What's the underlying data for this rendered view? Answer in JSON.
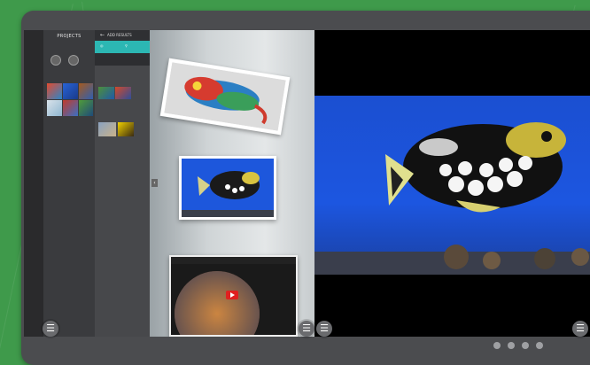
{
  "projects_panel": {
    "title": "PROJECTS"
  },
  "assets_panel": {
    "header": "ADD RESULTS"
  },
  "menu_buttons": {
    "glyph": "☰"
  },
  "icons": {
    "back_arrow": "arrow-left-icon",
    "collapse": "chevron-left-icon",
    "menu": "menu-icon",
    "play": "play-icon"
  },
  "pagination": {
    "pages": 4,
    "active_page": 1
  },
  "colors": {
    "accent": "#2cb7b3",
    "background": "#3f9a4b",
    "device": "#4b4c4f"
  }
}
